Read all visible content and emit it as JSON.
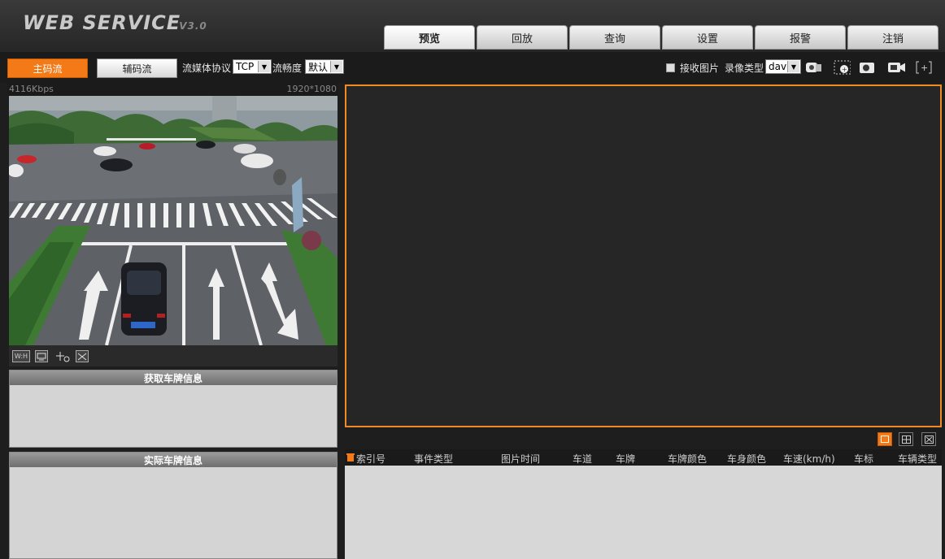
{
  "header": {
    "logo_main": "WEB  SERVICE",
    "logo_version": "V3.0",
    "tabs": [
      "预览",
      "回放",
      "查询",
      "设置",
      "报警",
      "注销"
    ]
  },
  "toolbar": {
    "main_stream": "主码流",
    "sub_stream": "辅码流",
    "protocol_label": "流媒体协议",
    "protocol_value": "TCP",
    "fluency_label": "流畅度",
    "fluency_value": "默认",
    "receive_image_label": "接收图片",
    "record_type_label": "录像类型",
    "record_type_value": "dav"
  },
  "video": {
    "bitrate": "4116Kbps",
    "resolution": "1920*1080",
    "controls": [
      "W:H"
    ]
  },
  "panels": {
    "get_plate_title": "获取车牌信息",
    "actual_plate_title": "实际车牌信息"
  },
  "table": {
    "columns": [
      "索引号",
      "事件类型",
      "图片时间",
      "车道",
      "车牌",
      "车牌颜色",
      "车身颜色",
      "车速(km/h)",
      "车标",
      "车辆类型"
    ]
  },
  "colors": {
    "accent": "#f47a18",
    "preview_border": "#f08a24"
  }
}
